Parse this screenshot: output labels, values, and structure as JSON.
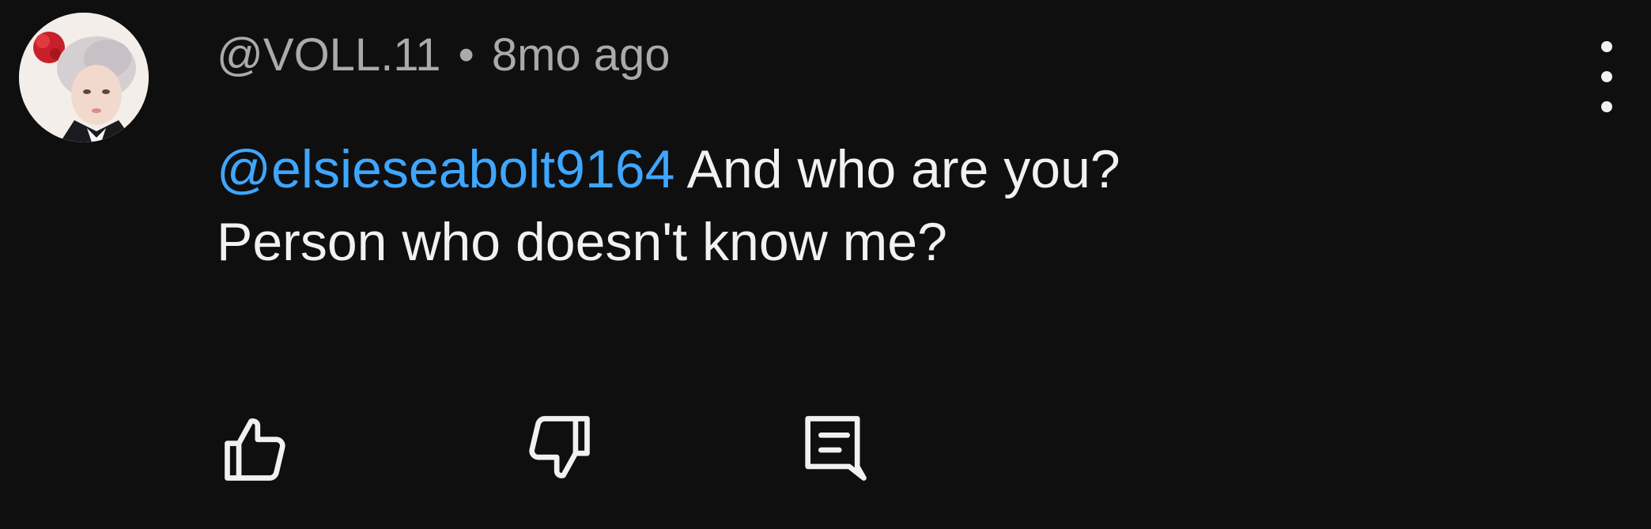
{
  "comment": {
    "author": "@VOLL.11",
    "separator": "•",
    "timestamp": "8mo ago",
    "mention": "@elsieseabolt9164",
    "text_line1": " And who are you?",
    "text_line2": "Person who doesn't know me?"
  },
  "icons": {
    "more": "more-vertical-icon",
    "like": "thumbs-up-icon",
    "dislike": "thumbs-down-icon",
    "reply": "reply-comment-icon"
  },
  "colors": {
    "background": "#0f0f0f",
    "text": "#f1f1f1",
    "meta_text": "#aaaaaa",
    "mention": "#3ea6ff"
  }
}
